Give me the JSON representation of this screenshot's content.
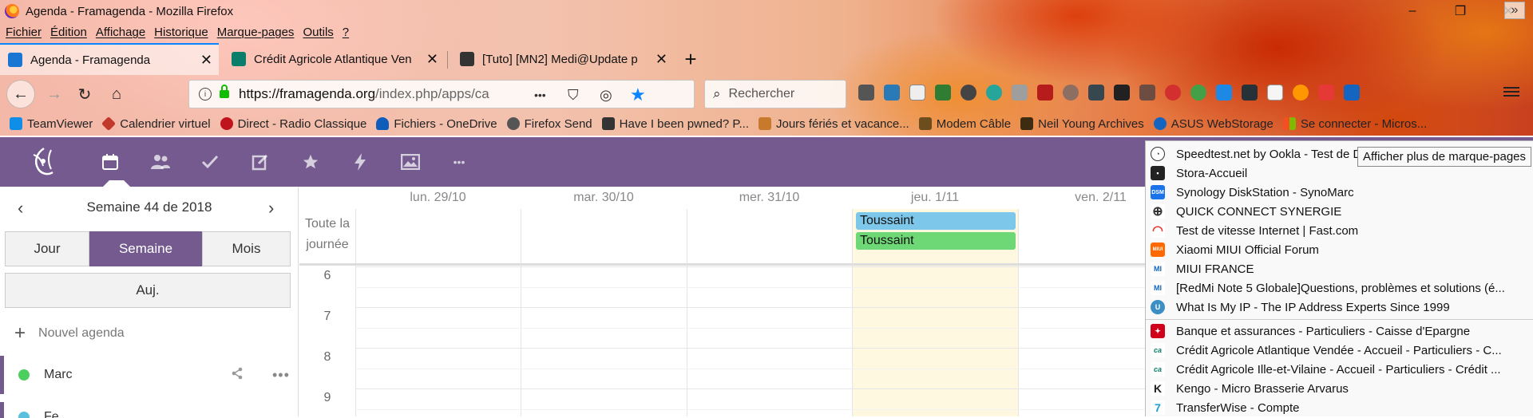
{
  "window": {
    "title": "Agenda - Framagenda - Mozilla Firefox",
    "controls": [
      "–",
      "❐",
      "✕"
    ]
  },
  "menubar": [
    "Fichier",
    "Édition",
    "Affichage",
    "Historique",
    "Marque-pages",
    "Outils",
    "?"
  ],
  "tabs": [
    {
      "label": "Agenda - Framagenda",
      "close": "✕",
      "active": true
    },
    {
      "label": "Crédit Agricole Atlantique Ven",
      "close": "✕",
      "active": false
    },
    {
      "label": "[Tuto] [MN2] Medi@Update p",
      "close": "✕",
      "active": false
    }
  ],
  "newtab": "+",
  "navbar": {
    "back": "←",
    "forward": "→",
    "reload": "↻",
    "home": "⌂",
    "url_host": "https://framagenda.org",
    "url_path": "/index.php/apps/ca",
    "info": "i",
    "page_actions": "•••",
    "search_placeholder": "Rechercher",
    "search_icon": "⌕"
  },
  "bookmarks": [
    {
      "label": "TeamViewer",
      "color": "#0e8ee9"
    },
    {
      "label": "Calendrier virtuel",
      "color": "#c0392b"
    },
    {
      "label": "Direct - Radio Classique",
      "color": "#c0141c"
    },
    {
      "label": "Fichiers - OneDrive",
      "color": "#0f5dbb"
    },
    {
      "label": "Firefox Send",
      "color": "#555555"
    },
    {
      "label": "Have I been pwned? P...",
      "color": "#333333"
    },
    {
      "label": "Jours fériés et vacance...",
      "color": "#c77a2c"
    },
    {
      "label": "Modem Câble",
      "color": "#6b4d1e"
    },
    {
      "label": "Neil Young Archives",
      "color": "#3d2b12"
    },
    {
      "label": "ASUS WebStorage",
      "color": "#1565c0"
    },
    {
      "label": "Se connecter - Micros...",
      "color": "#f25022"
    }
  ],
  "bookmarks_more": "»",
  "tooltip": "Afficher plus de marque-pages",
  "app": {
    "nav_icons": [
      "calendar-icon",
      "contacts-icon",
      "tasks-icon",
      "notes-icon",
      "favorites-icon",
      "activity-icon",
      "gallery-icon",
      "more-icon"
    ],
    "nav_glyphs": [
      "📅",
      "👥",
      "✓",
      "✎",
      "★",
      "⚡",
      "🖼",
      "•••"
    ]
  },
  "sidebar": {
    "prev": "‹",
    "next": "›",
    "week_label": "Semaine 44 de 2018",
    "views": [
      "Jour",
      "Semaine",
      "Mois"
    ],
    "active_view": "Semaine",
    "today": "Auj.",
    "new_calendar": "Nouvel agenda",
    "new_calendar_plus": "+",
    "calendars": [
      {
        "name": "Marc",
        "color": "#4ccf5f"
      },
      {
        "name": "Fe...",
        "color": "#5bc0de"
      }
    ],
    "share_glyph": "⋖",
    "more_glyph": "•••"
  },
  "calendar": {
    "days": [
      "lun. 29/10",
      "mar. 30/10",
      "mer. 31/10",
      "jeu. 1/11",
      "ven. 2/11"
    ],
    "today_index": 3,
    "allday_label_1": "Toute la",
    "allday_label_2": "journée",
    "hours": [
      "6",
      "7",
      "8",
      "9"
    ],
    "events": [
      {
        "title": "Toussaint",
        "color": "#7cc7ea"
      },
      {
        "title": "Toussaint",
        "color": "#6fd876"
      }
    ]
  },
  "dropdown": [
    {
      "label": "Speedtest.net by Ookla - Test de D",
      "icon": "speedtest-icon",
      "color": "#333333",
      "glyph": "◔"
    },
    {
      "label": "Stora-Accueil",
      "icon": "stora-icon",
      "color": "#222222",
      "glyph": "▪"
    },
    {
      "label": "Synology DiskStation - SynoMarc",
      "icon": "synology-icon",
      "color": "#1a73e8",
      "glyph": "DSM"
    },
    {
      "label": "QUICK CONNECT SYNERGIE",
      "icon": "globe-icon",
      "color": "#444444",
      "glyph": "⊕"
    },
    {
      "label": "Test de vitesse Internet | Fast.com",
      "icon": "fast-icon",
      "color": "#e53935",
      "glyph": "◠"
    },
    {
      "label": "Xiaomi MIUI Official Forum",
      "icon": "miui-icon",
      "color": "#ff6900",
      "glyph": "MIUI"
    },
    {
      "label": "MIUI FRANCE",
      "icon": "mi-icon",
      "color": "#1565c0",
      "glyph": "MI"
    },
    {
      "label": "[RedMi Note 5 Globale]Questions, problèmes et solutions (é...",
      "icon": "mi-icon",
      "color": "#1565c0",
      "glyph": "MI"
    },
    {
      "label": "What Is My IP - The IP Address Experts Since 1999",
      "icon": "whatismyip-icon",
      "color": "#3b8fc4",
      "glyph": "U"
    },
    {
      "label": "Banque et assurances - Particuliers - Caisse d'Epargne",
      "icon": "caisse-epargne-icon",
      "color": "#d0021b",
      "glyph": "✦"
    },
    {
      "label": "Crédit Agricole Atlantique Vendée - Accueil - Particuliers - C...",
      "icon": "credit-agricole-icon",
      "color": "#0a7e6a",
      "glyph": "ca"
    },
    {
      "label": "Crédit Agricole Ille-et-Vilaine - Accueil - Particuliers - Crédit ...",
      "icon": "credit-agricole-icon",
      "color": "#0a7e6a",
      "glyph": "ca"
    },
    {
      "label": "Kengo - Micro Brasserie Arvarus",
      "icon": "kengo-icon",
      "color": "#222222",
      "glyph": "K"
    },
    {
      "label": "TransferWise - Compte",
      "icon": "transferwise-icon",
      "color": "#1b9ad6",
      "glyph": "7"
    }
  ]
}
